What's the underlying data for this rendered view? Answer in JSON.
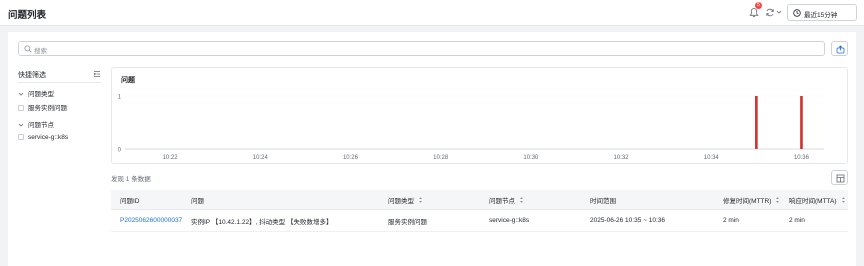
{
  "header": {
    "title": "问题列表",
    "notification_count": "5",
    "time_range": "最近15分钟"
  },
  "search": {
    "placeholder": "搜索"
  },
  "sidebar": {
    "title": "快捷筛选",
    "groups": [
      {
        "label": "问题类型",
        "options": [
          "服务实例问题"
        ]
      },
      {
        "label": "问题节点",
        "options": [
          "service-g::k8s"
        ]
      }
    ]
  },
  "chart": {
    "title": "问题"
  },
  "chart_data": {
    "type": "bar",
    "title": "问题",
    "x_ticks": [
      "10:22",
      "10:24",
      "10:26",
      "10:28",
      "10:30",
      "10:32",
      "10:34",
      "10:36"
    ],
    "y_ticks": [
      "0",
      "1"
    ],
    "ylim": [
      0,
      1
    ],
    "xlim": [
      "10:21",
      "10:36.5"
    ],
    "bars": [
      {
        "x": "10:35",
        "value": 1
      },
      {
        "x": "10:36",
        "value": 1
      }
    ],
    "bar_color": "#d0312d",
    "grid": true
  },
  "results": {
    "summary": "发现 1 条数据"
  },
  "table": {
    "columns": [
      "问题ID",
      "问题",
      "问题类型",
      "问题节点",
      "时间范围",
      "修复时间(MTTR)",
      "响应时间(MTTA)"
    ],
    "rows": [
      [
        "P2025062600000037",
        "实例IP 【10.42.1.22】, 抖动类型 【失败数增多】",
        "服务实例问题",
        "service-g::k8s",
        "2025-06-26 10:35 ~ 10:36",
        "2 min",
        "2 min"
      ]
    ]
  },
  "colors": {
    "accent": "#1f6fde",
    "bar": "#d0312d",
    "badge": "#f54a45"
  }
}
